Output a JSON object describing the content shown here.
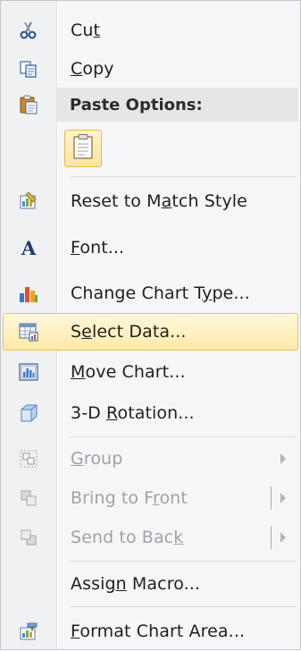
{
  "menu": {
    "cut": {
      "pre": "Cu",
      "key": "t",
      "post": "",
      "icon": "scissors-icon"
    },
    "copy": {
      "pre": "",
      "key": "C",
      "post": "opy",
      "icon": "copy-icon"
    },
    "paste_header": "Paste Options:",
    "paste_option": {
      "icon": "paste-icon"
    },
    "reset": {
      "pre": "Reset to M",
      "key": "a",
      "post": "tch Style",
      "icon": "reset-style-icon"
    },
    "font": {
      "pre": "",
      "key": "F",
      "post": "ont...",
      "icon": "font-icon"
    },
    "change_chart_type": {
      "pre": "Change Chart T",
      "key": "y",
      "post": "pe...",
      "icon": "chart-type-icon"
    },
    "select_data": {
      "pre": "S",
      "key": "e",
      "post": "lect Data...",
      "icon": "select-data-icon"
    },
    "move_chart": {
      "pre": "",
      "key": "M",
      "post": "ove Chart...",
      "icon": "move-chart-icon"
    },
    "rotation_3d": {
      "pre": "3-D ",
      "key": "R",
      "post": "otation...",
      "icon": "cube-icon"
    },
    "group": {
      "pre": "",
      "key": "G",
      "post": "roup",
      "icon": "group-icon",
      "disabled": true
    },
    "bring_to_front": {
      "pre": "Bring to F",
      "key": "r",
      "post": "ont",
      "icon": "bring-front-icon",
      "disabled": true
    },
    "send_to_back": {
      "pre": "Send to Bac",
      "key": "k",
      "post": "",
      "icon": "send-back-icon",
      "disabled": true
    },
    "assign_macro": {
      "pre": "Assig",
      "key": "n",
      "post": " Macro...",
      "icon": "macro-icon"
    },
    "format_chart_area": {
      "pre": "",
      "key": "F",
      "post": "ormat Chart Area...",
      "icon": "format-icon"
    }
  },
  "colors": {
    "highlight_border": "#e8c45b",
    "highlight_fill": "#ffe9a8",
    "disabled_text": "#9ea3a8"
  }
}
